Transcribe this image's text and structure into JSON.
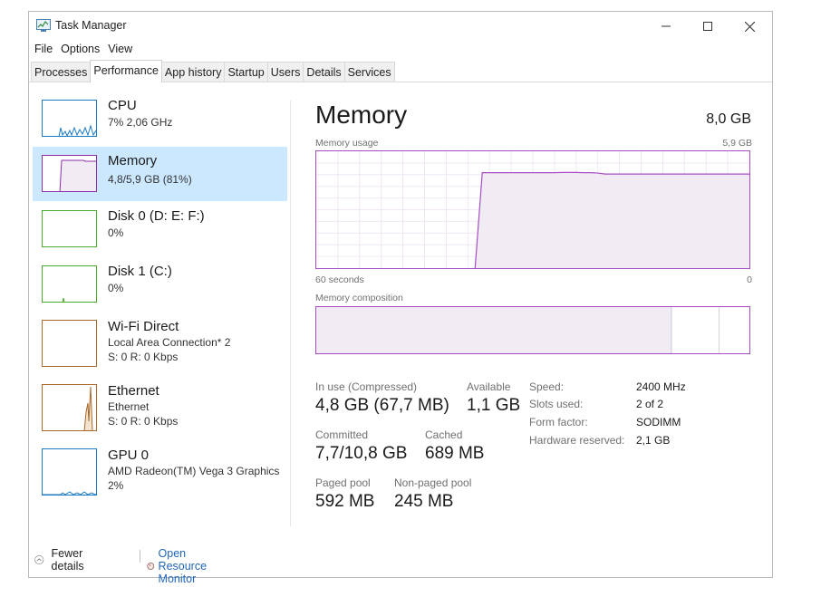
{
  "window": {
    "title": "Task Manager"
  },
  "menu": [
    "File",
    "Options",
    "View"
  ],
  "tabs": [
    "Processes",
    "Performance",
    "App history",
    "Startup",
    "Users",
    "Details",
    "Services"
  ],
  "active_tab": "Performance",
  "sidebar": {
    "items": [
      {
        "title": "CPU",
        "line1": "7% 2,06 GHz",
        "line2": "",
        "color": "#1a7bc4"
      },
      {
        "title": "Memory",
        "line1": "4,8/5,9 GB (81%)",
        "line2": "",
        "color": "#8b2fa8",
        "selected": true
      },
      {
        "title": "Disk 0 (D: E: F:)",
        "line1": "0%",
        "line2": "",
        "color": "#4caa2b"
      },
      {
        "title": "Disk 1 (C:)",
        "line1": "0%",
        "line2": "",
        "color": "#4caa2b"
      },
      {
        "title": "Wi-Fi Direct",
        "line1": "Local Area Connection* 2",
        "line2": "S: 0 R: 0 Kbps",
        "color": "#a8692a"
      },
      {
        "title": "Ethernet",
        "line1": "Ethernet",
        "line2": "S: 0 R: 0 Kbps",
        "color": "#a8692a"
      },
      {
        "title": "GPU 0",
        "line1": "AMD Radeon(TM) Vega 3 Graphics",
        "line2": "2%",
        "color": "#1a7bc4"
      }
    ]
  },
  "main": {
    "title": "Memory",
    "total": "8,0 GB",
    "usage_label": "Memory usage",
    "usage_max": "5,9 GB",
    "time_left": "60 seconds",
    "time_right": "0",
    "composition_label": "Memory composition",
    "usage_history_gb": [
      0,
      0,
      0,
      0,
      0,
      0,
      0,
      0,
      0,
      0,
      0,
      0,
      0,
      0,
      0,
      0,
      0,
      0,
      0,
      0,
      0,
      0,
      0,
      4.82,
      4.82,
      4.82,
      4.82,
      4.82,
      4.82,
      4.82,
      4.82,
      4.82,
      4.82,
      4.82,
      4.83,
      4.83,
      4.83,
      4.82,
      4.82,
      4.8,
      4.75,
      4.75,
      4.75,
      4.75,
      4.75,
      4.75,
      4.75,
      4.75,
      4.75,
      4.75,
      4.75,
      4.75,
      4.75,
      4.75,
      4.75,
      4.75,
      4.75,
      4.75,
      4.75,
      4.75,
      4.75
    ],
    "usage_max_gb": 5.9,
    "composition": {
      "in_use_fraction": 0.82,
      "modified_fraction": 0.0,
      "standby_fraction": 0.11
    }
  },
  "stats": {
    "in_use_label": "In use (Compressed)",
    "in_use_value": "4,8 GB (67,7 MB)",
    "available_label": "Available",
    "available_value": "1,1 GB",
    "committed_label": "Committed",
    "committed_value": "7,7/10,8 GB",
    "cached_label": "Cached",
    "cached_value": "689 MB",
    "paged_label": "Paged pool",
    "paged_value": "592 MB",
    "nonpaged_label": "Non-paged pool",
    "nonpaged_value": "245 MB"
  },
  "specs": {
    "speed_label": "Speed:",
    "speed_value": "2400 MHz",
    "slots_label": "Slots used:",
    "slots_value": "2 of 2",
    "form_label": "Form factor:",
    "form_value": "SODIMM",
    "hw_label": "Hardware reserved:",
    "hw_value": "2,1 GB"
  },
  "footer": {
    "fewer_details": "Fewer details",
    "open_resource_monitor": "Open Resource Monitor"
  },
  "colors": {
    "memory": "#a64dc4",
    "memory_fill": "#f1ecf4",
    "selected": "#cce8ff",
    "link": "#1f66b8"
  }
}
